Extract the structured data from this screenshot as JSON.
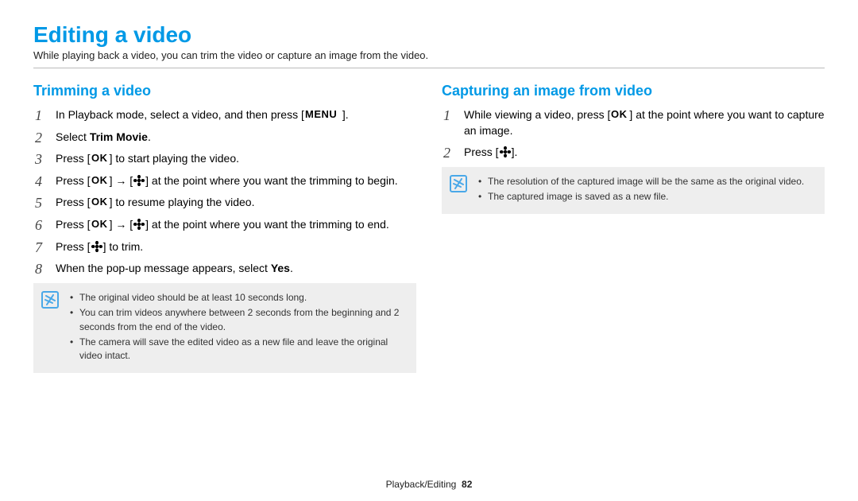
{
  "title": "Editing a video",
  "intro": "While playing back a video, you can trim the video or capture an image from the video.",
  "left": {
    "heading": "Trimming a video",
    "steps": {
      "s1a": "In Playback mode, select a video, and then press [",
      "s1b": "].",
      "s2a": "Select ",
      "s2bold": "Trim Movie",
      "s2b": ".",
      "s3a": "Press [",
      "s3b": "] to start playing the video.",
      "s4a": "Press [",
      "s4b": "] → [",
      "s4c": "] at the point where you want the trimming to begin.",
      "s5a": "Press [",
      "s5b": "] to resume playing the video.",
      "s6a": "Press [",
      "s6b": "] → [",
      "s6c": "] at the point where you want the trimming to end.",
      "s7a": "Press [",
      "s7b": "] to trim.",
      "s8a": "When the pop-up message appears, select ",
      "s8bold": "Yes",
      "s8b": "."
    },
    "notes": [
      "The original video should be at least 10 seconds long.",
      "You can trim videos anywhere between 2 seconds from the beginning and 2 seconds from the end of the video.",
      "The camera will save the edited video as a new file and leave the original video intact."
    ]
  },
  "right": {
    "heading": "Capturing an image from video",
    "steps": {
      "s1a": "While viewing a video, press [",
      "s1b": "] at the point where you want to capture an image.",
      "s2a": "Press [",
      "s2b": "]."
    },
    "notes": [
      "The resolution of the captured image will be the same as the original video.",
      "The captured image is saved as a new file."
    ]
  },
  "footer": {
    "section": "Playback/Editing",
    "page": "82"
  },
  "iconAlt": {
    "menu": "MENU",
    "ok": "OK",
    "flower": "flower/close-up",
    "info": "info"
  }
}
